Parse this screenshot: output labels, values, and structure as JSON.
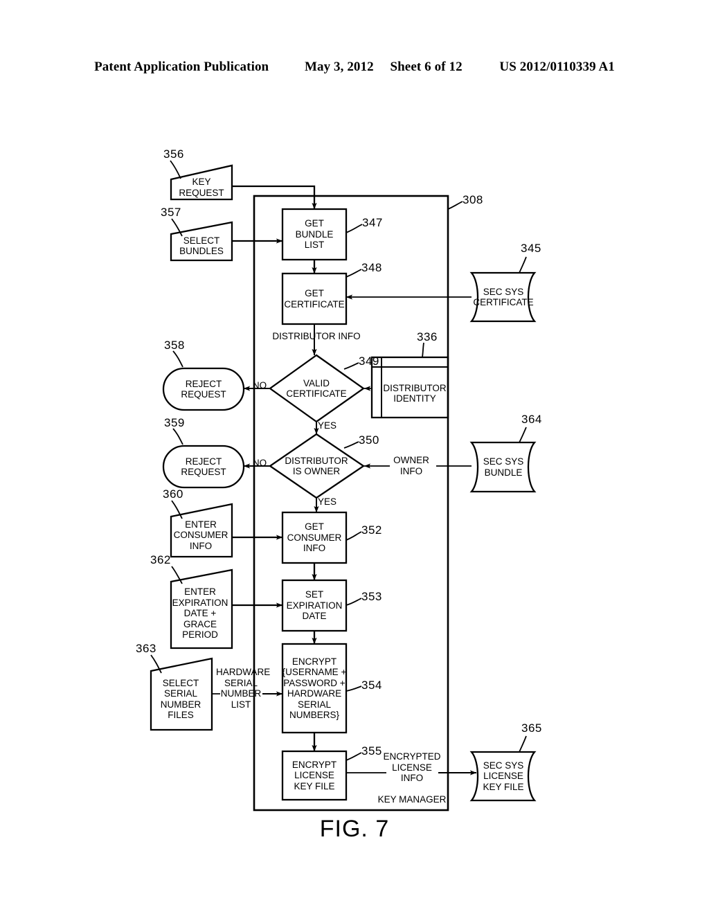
{
  "header": {
    "publication": "Patent Application Publication",
    "date": "May 3, 2012",
    "sheet": "Sheet 6 of 12",
    "number": "US 2012/0110339 A1"
  },
  "figure": {
    "caption": "FIG. 7",
    "container_label": "KEY MANAGER",
    "container_ref": "308"
  },
  "nodes": {
    "key_request": {
      "label": "KEY\nREQUEST",
      "ref": "356",
      "shape": "manual-input"
    },
    "select_bundles": {
      "label": "SELECT\nBUNDLES",
      "ref": "357",
      "shape": "manual-input"
    },
    "get_bundle_list": {
      "label": "GET\nBUNDLE\nLIST",
      "ref": "347",
      "shape": "process"
    },
    "get_certificate": {
      "label": "GET\nCERTIFICATE",
      "ref": "348",
      "shape": "process"
    },
    "sec_sys_certificate": {
      "label": "SEC SYS\nCERTIFICATE",
      "ref": "345",
      "shape": "stored-data"
    },
    "valid_certificate": {
      "label": "VALID\nCERTIFICATE",
      "ref": "349",
      "shape": "decision"
    },
    "distributor_identity": {
      "label": "DISTRIBUTOR\nIDENTITY",
      "ref": "336",
      "shape": "internal-storage"
    },
    "reject_request_1": {
      "label": "REJECT\nREQUEST",
      "ref": "358",
      "shape": "terminator"
    },
    "distributor_is_owner": {
      "label": "DISTRIBUTOR\nIS OWNER",
      "ref": "350",
      "shape": "decision"
    },
    "sec_sys_bundle": {
      "label": "SEC SYS\nBUNDLE",
      "ref": "364",
      "shape": "stored-data"
    },
    "reject_request_2": {
      "label": "REJECT\nREQUEST",
      "ref": "359",
      "shape": "terminator"
    },
    "enter_consumer_info": {
      "label": "ENTER\nCONSUMER\nINFO",
      "ref": "360",
      "shape": "manual-input"
    },
    "get_consumer_info": {
      "label": "GET\nCONSUMER\nINFO",
      "ref": "352",
      "shape": "process"
    },
    "enter_expiration": {
      "label": "ENTER\nEXPIRATION\nDATE +\nGRACE\nPERIOD",
      "ref": "362",
      "shape": "manual-input"
    },
    "set_expiration_date": {
      "label": "SET\nEXPIRATION\nDATE",
      "ref": "353",
      "shape": "process"
    },
    "select_serial_files": {
      "label": "SELECT\nSERIAL\nNUMBER\nFILES",
      "ref": "363",
      "shape": "manual-input"
    },
    "encrypt_credentials": {
      "label": "ENCRYPT\n{USERNAME +\nPASSWORD +\nHARDWARE\nSERIAL\nNUMBERS}",
      "ref": "354",
      "shape": "process"
    },
    "encrypt_license_key": {
      "label": "ENCRYPT\nLICENSE\nKEY FILE",
      "ref": "355",
      "shape": "process"
    },
    "sec_sys_license_key": {
      "label": "SEC SYS\nLICENSE\nKEY FILE",
      "ref": "365",
      "shape": "stored-data"
    }
  },
  "edge_labels": {
    "distributor_info": "DISTRIBUTOR INFO",
    "no_1": "NO",
    "yes_1": "YES",
    "no_2": "NO",
    "yes_2": "YES",
    "owner_info": "OWNER\nINFO",
    "hardware_serial_number_list": "HARDWARE\nSERIAL\nNUMBER\nLIST",
    "encrypted_license_info": "ENCRYPTED\nLICENSE\nINFO"
  },
  "colors": {
    "ink": "#000000",
    "paper": "#ffffff"
  }
}
